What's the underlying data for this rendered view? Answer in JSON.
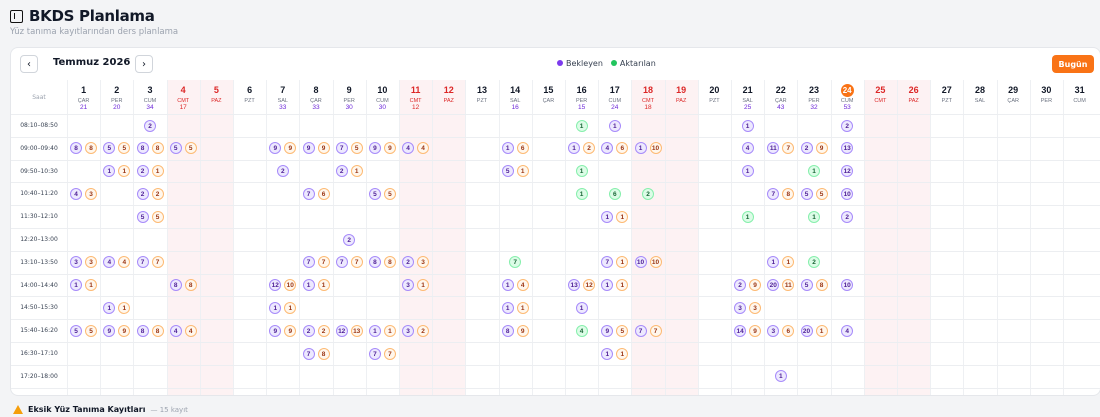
{
  "page": {
    "title": "BKDS Planlama",
    "subtitle": "Yüz tanıma kayıtlarından ders planlama"
  },
  "toolbar": {
    "prev": "‹",
    "next": "›",
    "month": "Temmuz 2026",
    "legend_pending": "Bekleyen",
    "legend_active": "Aktarılan",
    "today": "Bugün"
  },
  "colors": {
    "accent": "#f97316",
    "pending": "#7c3aed",
    "active": "#22c55e"
  },
  "grid": {
    "time_header": "Saat",
    "days": [
      {
        "d": "1",
        "w": "ÇAR",
        "n": "21"
      },
      {
        "d": "2",
        "w": "PER",
        "n": "20"
      },
      {
        "d": "3",
        "w": "CUM",
        "n": "34"
      },
      {
        "d": "4",
        "w": "CMT",
        "n": "17",
        "r": 1
      },
      {
        "d": "5",
        "w": "PAZ",
        "n": "",
        "r": 1
      },
      {
        "d": "6",
        "w": "PZT",
        "n": ""
      },
      {
        "d": "7",
        "w": "SAL",
        "n": "33"
      },
      {
        "d": "8",
        "w": "ÇAR",
        "n": "33"
      },
      {
        "d": "9",
        "w": "PER",
        "n": "30"
      },
      {
        "d": "10",
        "w": "CUM",
        "n": "30"
      },
      {
        "d": "11",
        "w": "CMT",
        "n": "12",
        "r": 1
      },
      {
        "d": "12",
        "w": "PAZ",
        "n": "",
        "r": 1
      },
      {
        "d": "13",
        "w": "PZT",
        "n": ""
      },
      {
        "d": "14",
        "w": "SAL",
        "n": "16"
      },
      {
        "d": "15",
        "w": "ÇAR",
        "n": ""
      },
      {
        "d": "16",
        "w": "PER",
        "n": "15"
      },
      {
        "d": "17",
        "w": "CUM",
        "n": "24"
      },
      {
        "d": "18",
        "w": "CMT",
        "n": "18",
        "r": 1
      },
      {
        "d": "19",
        "w": "PAZ",
        "n": "",
        "r": 1
      },
      {
        "d": "20",
        "w": "PZT",
        "n": ""
      },
      {
        "d": "21",
        "w": "SAL",
        "n": "25"
      },
      {
        "d": "22",
        "w": "ÇAR",
        "n": "43"
      },
      {
        "d": "23",
        "w": "PER",
        "n": "32"
      },
      {
        "d": "24",
        "w": "CUM",
        "n": "53",
        "t": 1
      },
      {
        "d": "25",
        "w": "CMT",
        "n": "",
        "r": 1
      },
      {
        "d": "26",
        "w": "PAZ",
        "n": "",
        "r": 1
      },
      {
        "d": "27",
        "w": "PZT",
        "n": ""
      },
      {
        "d": "28",
        "w": "SAL",
        "n": ""
      },
      {
        "d": "29",
        "w": "ÇAR",
        "n": ""
      },
      {
        "d": "30",
        "w": "PER",
        "n": ""
      },
      {
        "d": "31",
        "w": "CUM",
        "n": ""
      }
    ],
    "slots": [
      "08:10–08:50",
      "09:00–09:40",
      "09:50–10:30",
      "10:40–11:20",
      "11:30–12:10",
      "12:20–13:00",
      "13:10–13:50",
      "14:00–14:40",
      "14:50–15:30",
      "15:40–16:20",
      "16:30–17:10",
      "17:20–18:00"
    ],
    "cells": [
      [
        0,
        2,
        [
          [
            "p",
            "2"
          ]
        ]
      ],
      [
        0,
        15,
        [
          [
            "g",
            "1"
          ]
        ]
      ],
      [
        0,
        16,
        [
          [
            "p",
            "1"
          ]
        ]
      ],
      [
        0,
        20,
        [
          [
            "p",
            "1"
          ]
        ]
      ],
      [
        0,
        23,
        [
          [
            "p",
            "2"
          ]
        ]
      ],
      [
        1,
        0,
        [
          [
            "p",
            "8"
          ],
          [
            "a",
            "8"
          ]
        ]
      ],
      [
        1,
        1,
        [
          [
            "p",
            "5"
          ],
          [
            "a",
            "5"
          ]
        ]
      ],
      [
        1,
        2,
        [
          [
            "p",
            "8"
          ],
          [
            "a",
            "8"
          ]
        ]
      ],
      [
        1,
        3,
        [
          [
            "p",
            "5"
          ],
          [
            "a",
            "5"
          ]
        ]
      ],
      [
        1,
        6,
        [
          [
            "p",
            "9"
          ],
          [
            "a",
            "9"
          ]
        ]
      ],
      [
        1,
        7,
        [
          [
            "p",
            "9"
          ],
          [
            "a",
            "9"
          ]
        ]
      ],
      [
        1,
        8,
        [
          [
            "p",
            "7"
          ],
          [
            "a",
            "5"
          ]
        ]
      ],
      [
        1,
        9,
        [
          [
            "p",
            "9"
          ],
          [
            "a",
            "9"
          ]
        ]
      ],
      [
        1,
        10,
        [
          [
            "p",
            "4"
          ],
          [
            "a",
            "4"
          ]
        ]
      ],
      [
        1,
        13,
        [
          [
            "p",
            "1"
          ],
          [
            "a",
            "6"
          ]
        ]
      ],
      [
        1,
        15,
        [
          [
            "p",
            "1"
          ],
          [
            "a",
            "2"
          ]
        ]
      ],
      [
        1,
        16,
        [
          [
            "p",
            "4"
          ],
          [
            "a",
            "6"
          ]
        ]
      ],
      [
        1,
        17,
        [
          [
            "p",
            "1"
          ],
          [
            "a",
            "10"
          ]
        ]
      ],
      [
        1,
        20,
        [
          [
            "p",
            "4"
          ]
        ]
      ],
      [
        1,
        21,
        [
          [
            "p",
            "11"
          ],
          [
            "a",
            "7"
          ]
        ]
      ],
      [
        1,
        22,
        [
          [
            "p",
            "2"
          ],
          [
            "a",
            "9"
          ]
        ]
      ],
      [
        1,
        23,
        [
          [
            "p",
            "13"
          ]
        ]
      ],
      [
        2,
        1,
        [
          [
            "p",
            "1"
          ],
          [
            "a",
            "1"
          ]
        ]
      ],
      [
        2,
        2,
        [
          [
            "p",
            "2"
          ],
          [
            "a",
            "1"
          ]
        ]
      ],
      [
        2,
        6,
        [
          [
            "p",
            "2"
          ]
        ]
      ],
      [
        2,
        8,
        [
          [
            "p",
            "2"
          ],
          [
            "a",
            "1"
          ]
        ]
      ],
      [
        2,
        13,
        [
          [
            "p",
            "5"
          ],
          [
            "a",
            "1"
          ]
        ]
      ],
      [
        2,
        15,
        [
          [
            "g",
            "1"
          ]
        ]
      ],
      [
        2,
        20,
        [
          [
            "p",
            "1"
          ]
        ]
      ],
      [
        2,
        22,
        [
          [
            "g",
            "1"
          ]
        ]
      ],
      [
        2,
        23,
        [
          [
            "p",
            "12"
          ]
        ]
      ],
      [
        3,
        0,
        [
          [
            "p",
            "4"
          ],
          [
            "a",
            "3"
          ]
        ]
      ],
      [
        3,
        2,
        [
          [
            "p",
            "2"
          ],
          [
            "a",
            "2"
          ]
        ]
      ],
      [
        3,
        7,
        [
          [
            "p",
            "7"
          ],
          [
            "a",
            "6"
          ]
        ]
      ],
      [
        3,
        9,
        [
          [
            "p",
            "5"
          ],
          [
            "a",
            "5"
          ]
        ]
      ],
      [
        3,
        15,
        [
          [
            "g",
            "1"
          ]
        ]
      ],
      [
        3,
        16,
        [
          [
            "g",
            "6"
          ]
        ]
      ],
      [
        3,
        17,
        [
          [
            "g",
            "2"
          ]
        ]
      ],
      [
        3,
        21,
        [
          [
            "p",
            "7"
          ],
          [
            "a",
            "8"
          ]
        ]
      ],
      [
        3,
        22,
        [
          [
            "p",
            "5"
          ],
          [
            "a",
            "5"
          ]
        ]
      ],
      [
        3,
        23,
        [
          [
            "p",
            "10"
          ]
        ]
      ],
      [
        4,
        2,
        [
          [
            "p",
            "5"
          ],
          [
            "a",
            "5"
          ]
        ]
      ],
      [
        4,
        16,
        [
          [
            "p",
            "1"
          ],
          [
            "a",
            "1"
          ]
        ]
      ],
      [
        4,
        20,
        [
          [
            "g",
            "1"
          ]
        ]
      ],
      [
        4,
        22,
        [
          [
            "g",
            "1"
          ]
        ]
      ],
      [
        4,
        23,
        [
          [
            "p",
            "2"
          ]
        ]
      ],
      [
        5,
        8,
        [
          [
            "p",
            "2"
          ]
        ]
      ],
      [
        6,
        0,
        [
          [
            "p",
            "3"
          ],
          [
            "a",
            "3"
          ]
        ]
      ],
      [
        6,
        1,
        [
          [
            "p",
            "4"
          ],
          [
            "a",
            "4"
          ]
        ]
      ],
      [
        6,
        2,
        [
          [
            "p",
            "7"
          ],
          [
            "a",
            "7"
          ]
        ]
      ],
      [
        6,
        7,
        [
          [
            "p",
            "7"
          ],
          [
            "a",
            "7"
          ]
        ]
      ],
      [
        6,
        8,
        [
          [
            "p",
            "7"
          ],
          [
            "a",
            "7"
          ]
        ]
      ],
      [
        6,
        9,
        [
          [
            "p",
            "8"
          ],
          [
            "a",
            "8"
          ]
        ]
      ],
      [
        6,
        10,
        [
          [
            "p",
            "2"
          ],
          [
            "a",
            "3"
          ]
        ]
      ],
      [
        6,
        13,
        [
          [
            "g",
            "7"
          ]
        ]
      ],
      [
        6,
        16,
        [
          [
            "p",
            "7"
          ],
          [
            "a",
            "1"
          ]
        ]
      ],
      [
        6,
        17,
        [
          [
            "p",
            "10"
          ],
          [
            "a",
            "10"
          ]
        ]
      ],
      [
        6,
        21,
        [
          [
            "p",
            "1"
          ],
          [
            "a",
            "1"
          ]
        ]
      ],
      [
        6,
        22,
        [
          [
            "g",
            "2"
          ]
        ]
      ],
      [
        7,
        0,
        [
          [
            "p",
            "1"
          ],
          [
            "a",
            "1"
          ]
        ]
      ],
      [
        7,
        3,
        [
          [
            "p",
            "8"
          ],
          [
            "a",
            "8"
          ]
        ]
      ],
      [
        7,
        6,
        [
          [
            "p",
            "12"
          ],
          [
            "a",
            "10"
          ]
        ]
      ],
      [
        7,
        7,
        [
          [
            "p",
            "1"
          ],
          [
            "a",
            "1"
          ]
        ]
      ],
      [
        7,
        10,
        [
          [
            "p",
            "3"
          ],
          [
            "a",
            "1"
          ]
        ]
      ],
      [
        7,
        13,
        [
          [
            "p",
            "1"
          ],
          [
            "a",
            "4"
          ]
        ]
      ],
      [
        7,
        15,
        [
          [
            "p",
            "13"
          ],
          [
            "a",
            "12"
          ]
        ]
      ],
      [
        7,
        16,
        [
          [
            "p",
            "1"
          ],
          [
            "a",
            "1"
          ]
        ]
      ],
      [
        7,
        20,
        [
          [
            "p",
            "2"
          ],
          [
            "a",
            "9"
          ]
        ]
      ],
      [
        7,
        21,
        [
          [
            "p",
            "20"
          ],
          [
            "a",
            "11"
          ]
        ]
      ],
      [
        7,
        22,
        [
          [
            "p",
            "5"
          ],
          [
            "a",
            "8"
          ]
        ]
      ],
      [
        7,
        23,
        [
          [
            "p",
            "10"
          ]
        ]
      ],
      [
        8,
        1,
        [
          [
            "p",
            "1"
          ],
          [
            "a",
            "1"
          ]
        ]
      ],
      [
        8,
        6,
        [
          [
            "p",
            "1"
          ],
          [
            "a",
            "1"
          ]
        ]
      ],
      [
        8,
        13,
        [
          [
            "p",
            "1"
          ],
          [
            "a",
            "1"
          ]
        ]
      ],
      [
        8,
        15,
        [
          [
            "p",
            "1"
          ]
        ]
      ],
      [
        8,
        20,
        [
          [
            "p",
            "3"
          ],
          [
            "a",
            "3"
          ]
        ]
      ],
      [
        9,
        0,
        [
          [
            "p",
            "5"
          ],
          [
            "a",
            "5"
          ]
        ]
      ],
      [
        9,
        1,
        [
          [
            "p",
            "9"
          ],
          [
            "a",
            "9"
          ]
        ]
      ],
      [
        9,
        2,
        [
          [
            "p",
            "8"
          ],
          [
            "a",
            "8"
          ]
        ]
      ],
      [
        9,
        3,
        [
          [
            "p",
            "4"
          ],
          [
            "a",
            "4"
          ]
        ]
      ],
      [
        9,
        6,
        [
          [
            "p",
            "9"
          ],
          [
            "a",
            "9"
          ]
        ]
      ],
      [
        9,
        7,
        [
          [
            "p",
            "2"
          ],
          [
            "a",
            "2"
          ]
        ]
      ],
      [
        9,
        8,
        [
          [
            "p",
            "12"
          ],
          [
            "a",
            "13"
          ]
        ]
      ],
      [
        9,
        9,
        [
          [
            "p",
            "1"
          ],
          [
            "a",
            "1"
          ]
        ]
      ],
      [
        9,
        10,
        [
          [
            "p",
            "3"
          ],
          [
            "a",
            "2"
          ]
        ]
      ],
      [
        9,
        13,
        [
          [
            "p",
            "8"
          ],
          [
            "a",
            "9"
          ]
        ]
      ],
      [
        9,
        15,
        [
          [
            "g",
            "4"
          ]
        ]
      ],
      [
        9,
        16,
        [
          [
            "p",
            "9"
          ],
          [
            "a",
            "5"
          ]
        ]
      ],
      [
        9,
        17,
        [
          [
            "p",
            "7"
          ],
          [
            "a",
            "7"
          ]
        ]
      ],
      [
        9,
        20,
        [
          [
            "p",
            "14"
          ],
          [
            "a",
            "9"
          ]
        ]
      ],
      [
        9,
        21,
        [
          [
            "p",
            "3"
          ],
          [
            "a",
            "6"
          ]
        ]
      ],
      [
        9,
        22,
        [
          [
            "p",
            "20"
          ],
          [
            "a",
            "1"
          ]
        ]
      ],
      [
        9,
        23,
        [
          [
            "p",
            "4"
          ]
        ]
      ],
      [
        10,
        7,
        [
          [
            "p",
            "7"
          ],
          [
            "a",
            "8"
          ]
        ]
      ],
      [
        10,
        9,
        [
          [
            "p",
            "7"
          ],
          [
            "a",
            "7"
          ]
        ]
      ],
      [
        10,
        16,
        [
          [
            "p",
            "1"
          ],
          [
            "a",
            "1"
          ]
        ]
      ],
      [
        11,
        21,
        [
          [
            "p",
            "1"
          ]
        ]
      ]
    ]
  },
  "bottom": {
    "title": "Eksik Yüz Tanıma Kayıtları",
    "count": "— 15 kayıt"
  }
}
